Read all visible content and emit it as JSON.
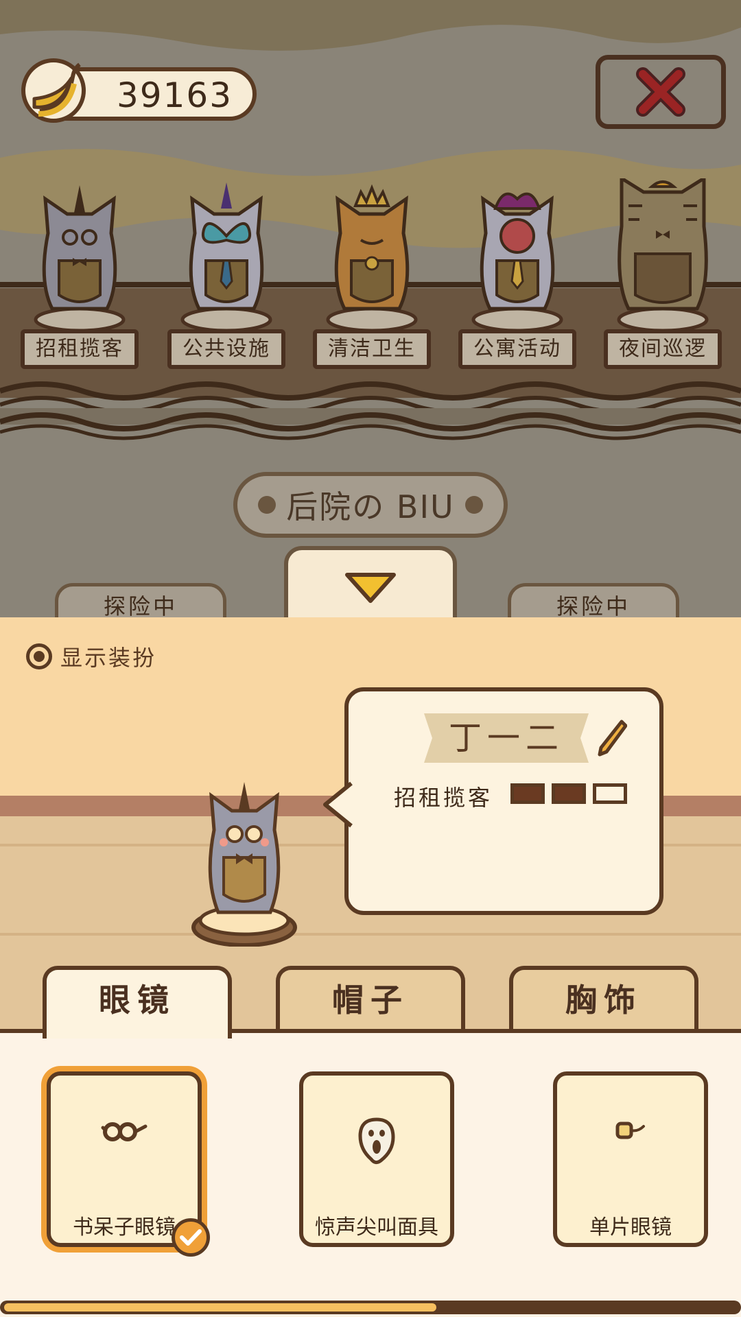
{
  "header": {
    "banana_count": "39163"
  },
  "stations": [
    {
      "label": "招租揽客"
    },
    {
      "label": "公共设施"
    },
    {
      "label": "清洁卫生"
    },
    {
      "label": "公寓活动"
    },
    {
      "label": "夜间巡逻"
    }
  ],
  "area_title": "后院の BIU",
  "expedition_tags": [
    "探险中",
    "探险中"
  ],
  "panel": {
    "show_costume_label": "显示装扮",
    "show_costume_checked": true,
    "character_name": "丁一二",
    "role": "招租揽客",
    "role_level": 2,
    "role_level_max": 3
  },
  "tabs": [
    {
      "label": "眼镜",
      "active": true
    },
    {
      "label": "帽子",
      "active": false
    },
    {
      "label": "胸饰",
      "active": false
    }
  ],
  "items": [
    {
      "label": "书呆子眼镜",
      "icon": "nerd-glasses-icon",
      "selected": true
    },
    {
      "label": "惊声尖叫面具",
      "icon": "scream-mask-icon",
      "selected": false
    },
    {
      "label": "单片眼镜",
      "icon": "monocle-icon",
      "selected": false
    }
  ],
  "colors": {
    "outline": "#5a3a22",
    "accent": "#f0a038",
    "panel_bg": "#f9d7a3",
    "close_x": "#b02a2a"
  }
}
